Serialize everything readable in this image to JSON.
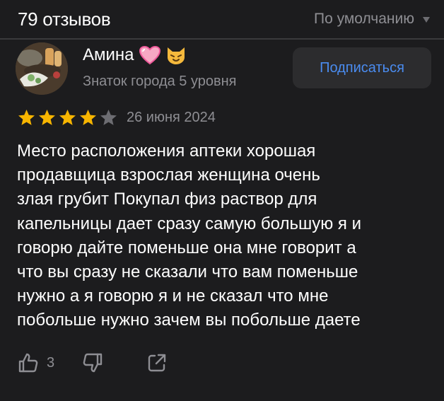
{
  "header": {
    "review_count": "79 отзывов",
    "sort_label": "По умолчанию"
  },
  "review": {
    "author_name": "Амина",
    "author_level": "Знаток города 5 уровня",
    "subscribe_label": "Подписаться",
    "rating": 4,
    "rating_max": 5,
    "date": "26 июня 2024",
    "text_lines": [
      "Место расположения аптеки хорошая",
      "продавщица взрослая женщина очень",
      "злая грубит Покупал физ раствор для",
      "капельницы дает сразу самую большую я и",
      "говорю дайте поменьше она мне говорит а",
      "что вы сразу не сказали что вам поменьше",
      "нужно а я говорю я и не сказал что мне",
      "побольше нужно зачем вы побольше даете"
    ],
    "likes": "3"
  },
  "icons": {
    "emoji_1": "heart-emoji-icon",
    "emoji_2": "cat-face-emoji-icon",
    "like": "thumbs-up-icon",
    "dislike": "thumbs-down-icon",
    "share": "share-icon"
  },
  "colors": {
    "background": "#1c1c1e",
    "star_filled": "#f7b500",
    "star_empty": "#6d6d72",
    "accent_link": "#4a8cf0",
    "muted_text": "#8e8e93"
  }
}
